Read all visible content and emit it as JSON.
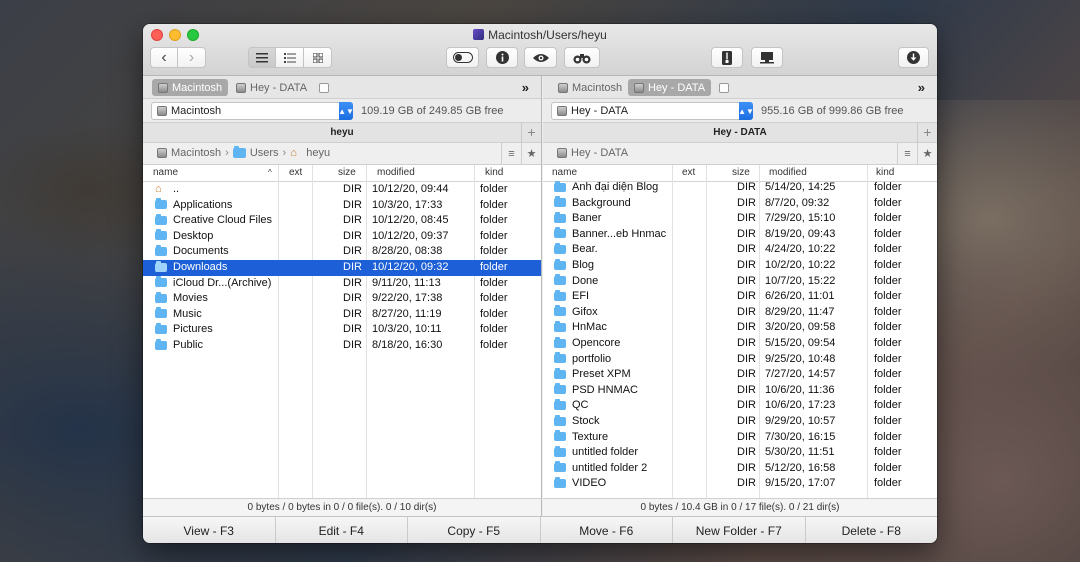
{
  "window": {
    "title": "Macintosh/Users/heyu"
  },
  "toolbar": {
    "back": "‹",
    "forward": "›",
    "view_icons": [
      "list-view-icon",
      "detail-view-icon",
      "thumbnail-view-icon"
    ],
    "icons": [
      "toggle-icon",
      "info-icon",
      "eye-icon",
      "binoculars-icon",
      "archive-icon",
      "network-icon",
      "download-icon"
    ]
  },
  "left": {
    "volumes": [
      "Macintosh",
      "Hey - DATA"
    ],
    "drive": "Macintosh",
    "free": "109.19 GB of 249.85 GB free",
    "path_title": "heyu",
    "crumbs": [
      "Macintosh",
      "Users",
      "heyu"
    ],
    "columns": {
      "name": "name",
      "ext": "ext",
      "size": "size",
      "modified": "modified",
      "kind": "kind"
    },
    "rows": [
      {
        "name": "..",
        "size": "DIR",
        "modified": "10/12/20, 09:44",
        "kind": "folder",
        "up": true
      },
      {
        "name": "Applications",
        "size": "DIR",
        "modified": "10/3/20, 17:33",
        "kind": "folder"
      },
      {
        "name": "Creative Cloud Files",
        "size": "DIR",
        "modified": "10/12/20, 08:45",
        "kind": "folder"
      },
      {
        "name": "Desktop",
        "size": "DIR",
        "modified": "10/12/20, 09:37",
        "kind": "folder"
      },
      {
        "name": "Documents",
        "size": "DIR",
        "modified": "8/28/20, 08:38",
        "kind": "folder"
      },
      {
        "name": "Downloads",
        "size": "DIR",
        "modified": "10/12/20, 09:32",
        "kind": "folder",
        "selected": true
      },
      {
        "name": "iCloud Dr...(Archive)",
        "size": "DIR",
        "modified": "9/11/20, 11:13",
        "kind": "folder"
      },
      {
        "name": "Movies",
        "size": "DIR",
        "modified": "9/22/20, 17:38",
        "kind": "folder"
      },
      {
        "name": "Music",
        "size": "DIR",
        "modified": "8/27/20, 11:19",
        "kind": "folder"
      },
      {
        "name": "Pictures",
        "size": "DIR",
        "modified": "10/3/20, 10:11",
        "kind": "folder"
      },
      {
        "name": "Public",
        "size": "DIR",
        "modified": "8/18/20, 16:30",
        "kind": "folder"
      }
    ],
    "status": "0 bytes / 0 bytes in 0 / 0 file(s). 0 / 10 dir(s)"
  },
  "right": {
    "volumes": [
      "Macintosh",
      "Hey - DATA"
    ],
    "drive": "Hey - DATA",
    "free": "955.16 GB of 999.86 GB free",
    "path_title": "Hey - DATA",
    "crumbs": [
      "Hey - DATA"
    ],
    "columns": {
      "name": "name",
      "ext": "ext",
      "size": "size",
      "modified": "modified",
      "kind": "kind"
    },
    "rows": [
      {
        "name": "Anh đại diện Blog",
        "size": "DIR",
        "modified": "5/14/20, 14:25",
        "kind": "folder"
      },
      {
        "name": "Background",
        "size": "DIR",
        "modified": "8/7/20, 09:32",
        "kind": "folder"
      },
      {
        "name": "Baner",
        "size": "DIR",
        "modified": "7/29/20, 15:10",
        "kind": "folder"
      },
      {
        "name": "Banner...eb Hnmac",
        "size": "DIR",
        "modified": "8/19/20, 09:43",
        "kind": "folder"
      },
      {
        "name": "Bear.",
        "size": "DIR",
        "modified": "4/24/20, 10:22",
        "kind": "folder"
      },
      {
        "name": "Blog",
        "size": "DIR",
        "modified": "10/2/20, 10:22",
        "kind": "folder"
      },
      {
        "name": "Done",
        "size": "DIR",
        "modified": "10/7/20, 15:22",
        "kind": "folder"
      },
      {
        "name": "EFI",
        "size": "DIR",
        "modified": "6/26/20, 11:01",
        "kind": "folder"
      },
      {
        "name": "Gifox",
        "size": "DIR",
        "modified": "8/29/20, 11:47",
        "kind": "folder"
      },
      {
        "name": "HnMac",
        "size": "DIR",
        "modified": "3/20/20, 09:58",
        "kind": "folder"
      },
      {
        "name": "Opencore",
        "size": "DIR",
        "modified": "5/15/20, 09:54",
        "kind": "folder"
      },
      {
        "name": "portfolio",
        "size": "DIR",
        "modified": "9/25/20, 10:48",
        "kind": "folder"
      },
      {
        "name": "Preset XPM",
        "size": "DIR",
        "modified": "7/27/20, 14:57",
        "kind": "folder"
      },
      {
        "name": "PSD HNMAC",
        "size": "DIR",
        "modified": "10/6/20, 11:36",
        "kind": "folder"
      },
      {
        "name": "QC",
        "size": "DIR",
        "modified": "10/6/20, 17:23",
        "kind": "folder"
      },
      {
        "name": "Stock",
        "size": "DIR",
        "modified": "9/29/20, 10:57",
        "kind": "folder"
      },
      {
        "name": "Texture",
        "size": "DIR",
        "modified": "7/30/20, 16:15",
        "kind": "folder"
      },
      {
        "name": "untitled folder",
        "size": "DIR",
        "modified": "5/30/20, 11:51",
        "kind": "folder"
      },
      {
        "name": "untitled folder 2",
        "size": "DIR",
        "modified": "5/12/20, 16:58",
        "kind": "folder"
      },
      {
        "name": "VIDEO",
        "size": "DIR",
        "modified": "9/15/20, 17:07",
        "kind": "folder"
      }
    ],
    "status": "0 bytes / 10.4 GB in 0 / 17 file(s). 0 / 21 dir(s)"
  },
  "fkeys": [
    "View - F3",
    "Edit - F4",
    "Copy - F5",
    "Move - F6",
    "New Folder - F7",
    "Delete - F8"
  ]
}
